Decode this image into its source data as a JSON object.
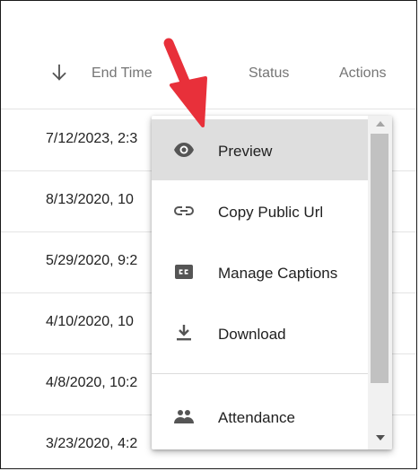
{
  "header": {
    "sort_icon": "arrow-down-icon",
    "end_time_label": "End Time",
    "status_label": "Status",
    "actions_label": "Actions"
  },
  "rows": [
    {
      "end_time": "7/12/2023, 2:3"
    },
    {
      "end_time": "8/13/2020, 10"
    },
    {
      "end_time": "5/29/2020, 9:2"
    },
    {
      "end_time": "4/10/2020, 10"
    },
    {
      "end_time": "4/8/2020, 10:2"
    },
    {
      "end_time": "3/23/2020, 4:2"
    }
  ],
  "menu": {
    "items": [
      {
        "label": "Preview",
        "icon": "eye-icon",
        "active": true
      },
      {
        "label": "Copy Public Url",
        "icon": "link-icon"
      },
      {
        "label": "Manage Captions",
        "icon": "closed-captions-icon"
      },
      {
        "label": "Download",
        "icon": "download-icon"
      },
      {
        "label": "Attendance",
        "icon": "people-icon"
      }
    ]
  },
  "annotation": {
    "icon": "red-arrow-icon",
    "color": "#e8303a"
  },
  "colors": {
    "highlight": "#dedede",
    "header_text": "#757575",
    "divider": "#e4e4e4"
  }
}
